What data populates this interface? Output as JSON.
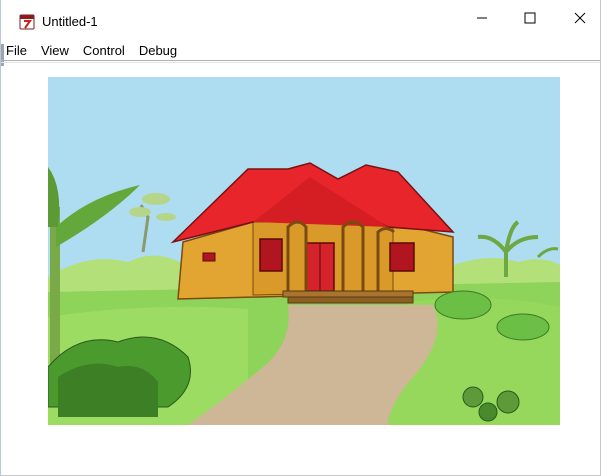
{
  "window": {
    "title": "Untitled-1",
    "icon": "flash-player-icon",
    "controls": [
      "minimize-icon",
      "maximize-icon",
      "close-icon"
    ]
  },
  "menubar": {
    "items": [
      "File",
      "View",
      "Control",
      "Debug"
    ]
  },
  "stage": {
    "content": "cartoon-house-illustration"
  },
  "colors": {
    "sky": "#aedcf0",
    "roof": "#e8252a",
    "wall": "#e3a532",
    "grass": "#8ed35a",
    "path": "#cdb797"
  }
}
